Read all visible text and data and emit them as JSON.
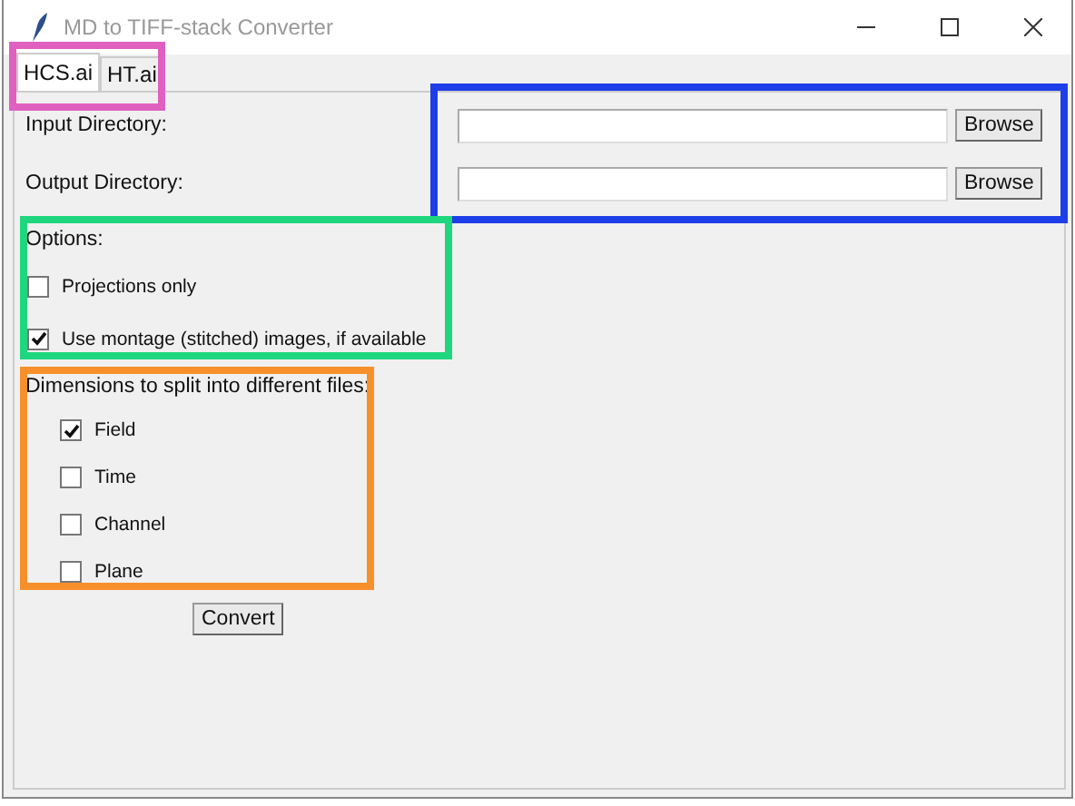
{
  "window": {
    "title": "MD to TIFF-stack Converter"
  },
  "tabs": [
    {
      "label": "HCS.ai",
      "selected": true
    },
    {
      "label": "HT.ai",
      "selected": false
    }
  ],
  "directories": [
    {
      "label": "Input Directory:",
      "button": "Browse"
    },
    {
      "label": "Output Directory:",
      "button": "Browse"
    }
  ],
  "options": {
    "heading": "Options:",
    "items": [
      {
        "label": "Projections only",
        "checked": false
      },
      {
        "label": "Use montage (stitched) images, if available",
        "checked": true
      }
    ]
  },
  "dimensions": {
    "heading": "Dimensions to split into different files:",
    "items": [
      {
        "label": "Field",
        "checked": true
      },
      {
        "label": "Time",
        "checked": false
      },
      {
        "label": "Channel",
        "checked": false
      },
      {
        "label": "Plane",
        "checked": false
      }
    ]
  },
  "convert_button": "Convert",
  "highlights": [
    {
      "color": "#e060c0"
    },
    {
      "color": "#1e3ee8"
    },
    {
      "color": "#1ed67e"
    },
    {
      "color": "#f7902a"
    }
  ]
}
